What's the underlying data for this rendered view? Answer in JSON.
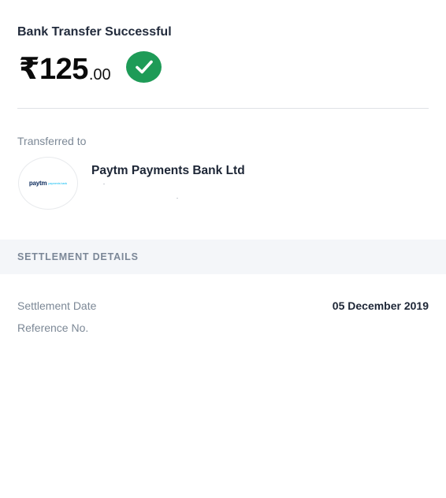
{
  "header": {
    "title": "Bank Transfer Successful",
    "amount_main": "₹125",
    "amount_decimal": ".00",
    "status_icon": "check-icon",
    "status_color": "#1e9b57"
  },
  "recipient": {
    "label": "Transferred to",
    "bank_name": "Paytm Payments Bank Ltd",
    "logo": {
      "brand": "paytm",
      "sub": "payments bank"
    }
  },
  "settlement": {
    "section_title": "SETTLEMENT DETAILS",
    "rows": [
      {
        "label": "Settlement Date",
        "value": "05 December 2019"
      },
      {
        "label": "Reference No.",
        "value": ""
      }
    ]
  }
}
